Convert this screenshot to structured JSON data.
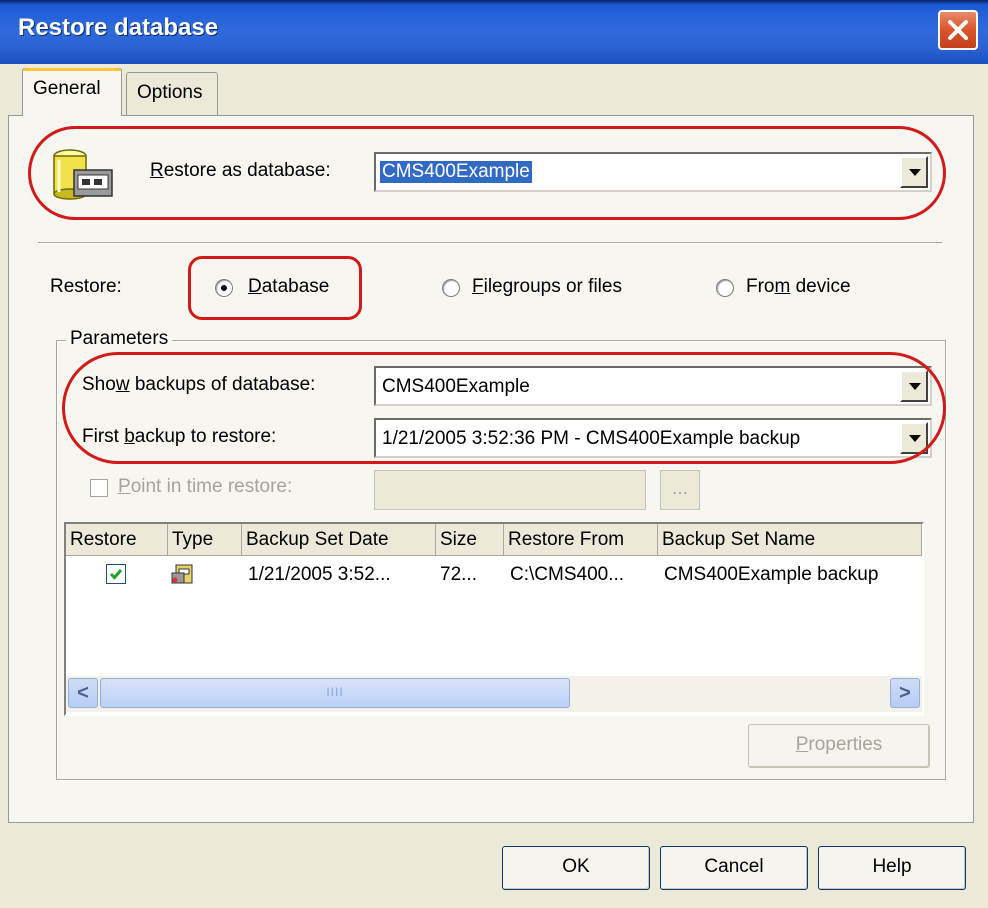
{
  "window": {
    "title": "Restore database",
    "close_glyph": "✕"
  },
  "tabs": [
    {
      "label": "General",
      "selected": true
    },
    {
      "label": "Options",
      "selected": false
    }
  ],
  "restore_as": {
    "label_prefix": "",
    "label_ul": "R",
    "label_rest": "estore as database:",
    "value": "CMS400Example"
  },
  "restore": {
    "label": "Restore:",
    "options": [
      {
        "ul": "D",
        "rest": "atabase",
        "pre": "",
        "selected": true
      },
      {
        "ul": "F",
        "rest": "ilegroups or files",
        "pre": "",
        "selected": false
      },
      {
        "ul": "m",
        "rest": " device",
        "pre": "Fro",
        "selected": false
      }
    ]
  },
  "parameters": {
    "legend": "Parameters",
    "show_backups": {
      "pre": "Sho",
      "ul": "w",
      "rest": " backups of database:",
      "value": "CMS400Example"
    },
    "first_backup": {
      "pre": "First ",
      "ul": "b",
      "rest": "ackup to restore:",
      "value": "1/21/2005 3:52:36 PM - CMS400Example backup"
    },
    "point_in_time": {
      "ul": "P",
      "rest": "oint in time restore:",
      "checked": false,
      "button_label": "..."
    }
  },
  "backup_list": {
    "columns": [
      "Restore",
      "Type",
      "Backup Set Date",
      "Size",
      "Restore From",
      "Backup Set Name"
    ],
    "rows": [
      {
        "restore": true,
        "type_icon": "database-backup-icon",
        "date": "1/21/2005 3:52...",
        "size": "72...",
        "from": "C:\\CMS400...",
        "name": "CMS400Example backup"
      }
    ],
    "scroll_left": "<",
    "scroll_right": ">",
    "thumb_grip": "IIII"
  },
  "buttons": {
    "properties_ul": "P",
    "properties_rest": "roperties",
    "ok": "OK",
    "cancel": "Cancel",
    "help": "Help"
  },
  "colors": {
    "titlebar": "#2f6bdc",
    "annotation": "#d21a1a",
    "selection": "#316ac5"
  }
}
